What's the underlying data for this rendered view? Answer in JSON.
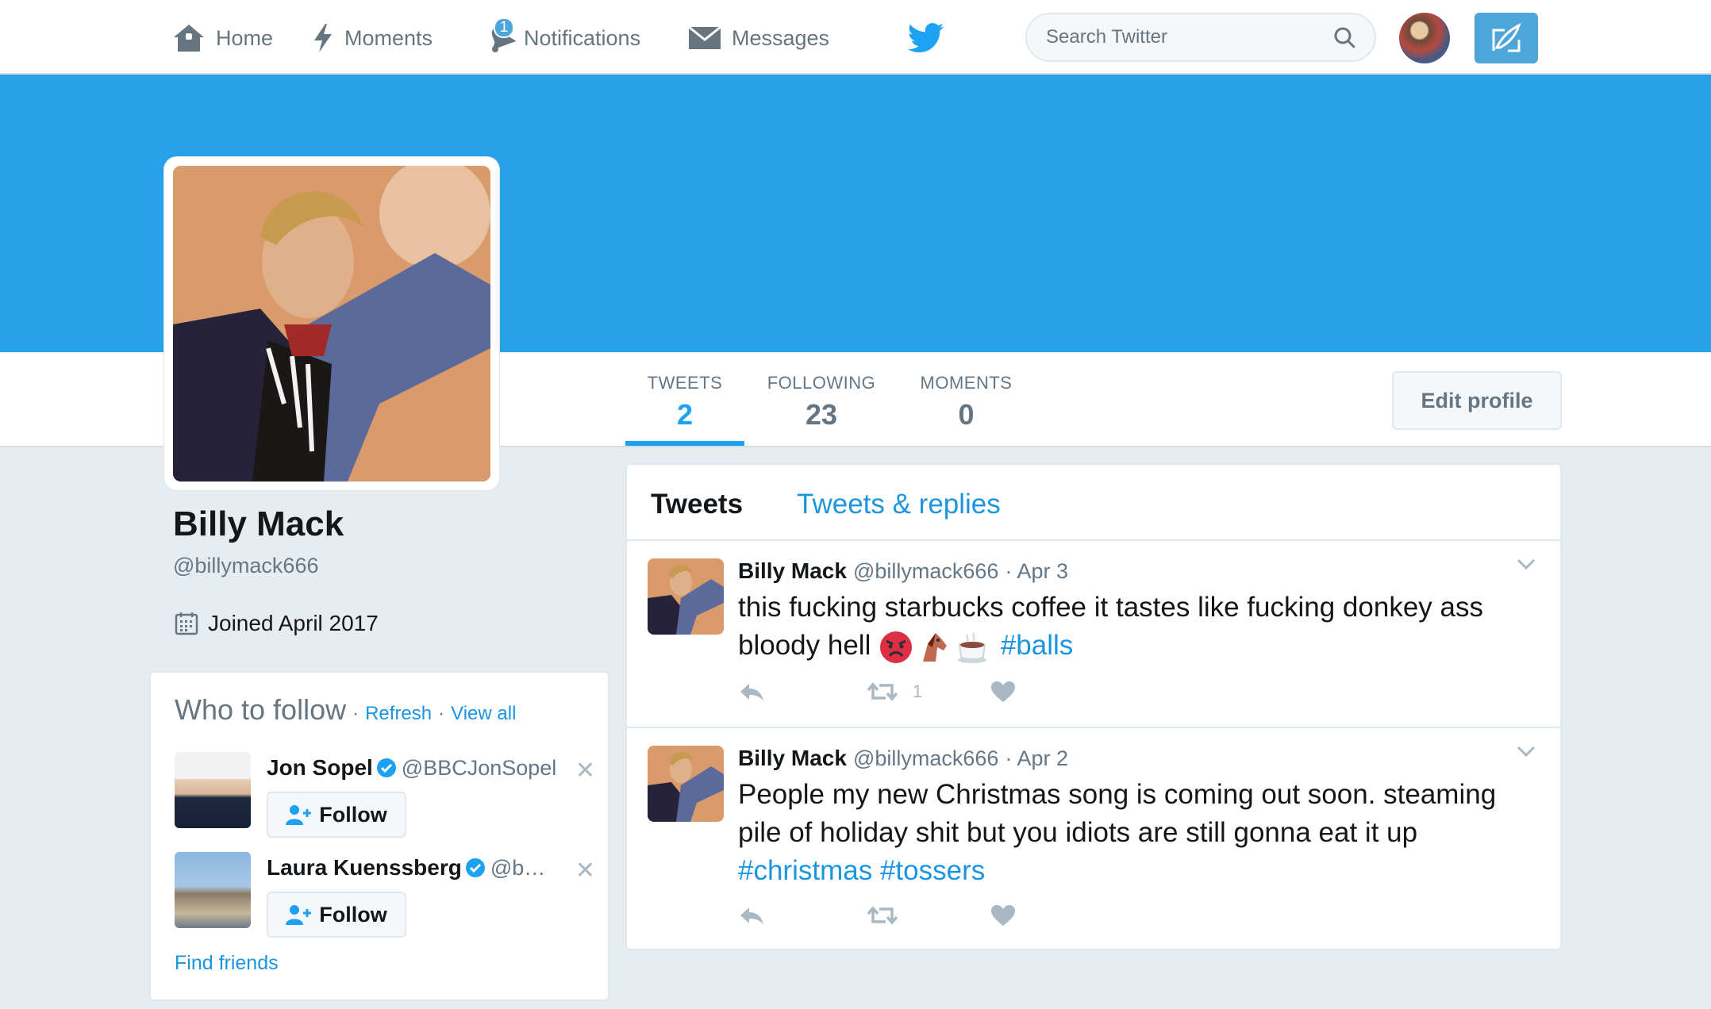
{
  "nav": {
    "home": "Home",
    "moments": "Moments",
    "notifications": "Notifications",
    "notification_count": "1",
    "messages": "Messages",
    "search_placeholder": "Search Twitter"
  },
  "profile": {
    "name": "Billy Mack",
    "handle": "@billymack666",
    "joined": "Joined April 2017",
    "banner_color": "#28a0ea"
  },
  "stats": {
    "tweets_label": "TWEETS",
    "tweets_value": "2",
    "following_label": "FOLLOWING",
    "following_value": "23",
    "moments_label": "MOMENTS",
    "moments_value": "0",
    "edit_profile": "Edit profile"
  },
  "who_to_follow": {
    "title": "Who to follow",
    "refresh": "Refresh",
    "view_all": "View all",
    "suggestions": [
      {
        "name": "Jon Sopel",
        "handle": "@BBCJonSopel",
        "follow": "Follow"
      },
      {
        "name": "Laura Kuenssberg",
        "handle": "@b…",
        "follow": "Follow"
      }
    ],
    "find_friends": "Find friends"
  },
  "timeline": {
    "tabs": [
      "Tweets",
      "Tweets & replies"
    ],
    "tweets": [
      {
        "name": "Billy Mack",
        "handle": "@billymack666",
        "date": "· Apr 3",
        "text": "this fucking starbucks coffee it tastes like fucking donkey ass bloody hell",
        "emojis": [
          "angry-face",
          "horse",
          "hot-beverage"
        ],
        "hashtags": [
          "#balls"
        ],
        "retweets": "1"
      },
      {
        "name": "Billy Mack",
        "handle": "@billymack666",
        "date": "· Apr 2",
        "text": "People my new Christmas song is coming out soon. steaming pile of holiday shit but you idiots are still gonna eat it up",
        "hashtags": [
          "#christmas",
          "#tossers"
        ],
        "retweets": ""
      }
    ]
  },
  "colors": {
    "accent": "#1da1f2",
    "link": "#1b95e0",
    "muted": "#657786"
  }
}
